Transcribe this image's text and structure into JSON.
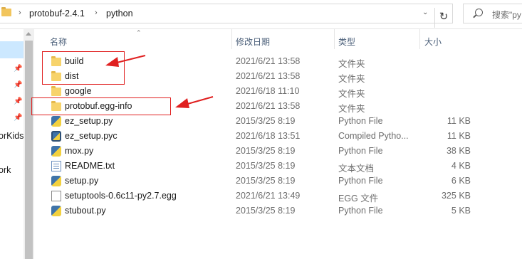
{
  "address": {
    "crumbs": [
      "protobuf-2.4.1",
      "python"
    ],
    "separator": "›",
    "dropdown_icon": "chevron-down-icon",
    "refresh_icon": "refresh-icon"
  },
  "search": {
    "placeholder": "搜索\"py"
  },
  "nav": {
    "labels": [
      "orKids",
      "ork"
    ]
  },
  "columns": {
    "name": "名称",
    "date": "修改日期",
    "type": "类型",
    "size": "大小"
  },
  "files": [
    {
      "name": "build",
      "date": "2021/6/21 13:58",
      "type": "文件夹",
      "size": "",
      "icon": "folder-icon"
    },
    {
      "name": "dist",
      "date": "2021/6/21 13:58",
      "type": "文件夹",
      "size": "",
      "icon": "folder-icon"
    },
    {
      "name": "google",
      "date": "2021/6/18 11:10",
      "type": "文件夹",
      "size": "",
      "icon": "folder-icon"
    },
    {
      "name": "protobuf.egg-info",
      "date": "2021/6/21 13:58",
      "type": "文件夹",
      "size": "",
      "icon": "folder-icon"
    },
    {
      "name": "ez_setup.py",
      "date": "2015/3/25 8:19",
      "type": "Python File",
      "size": "11 KB",
      "icon": "python-file-icon"
    },
    {
      "name": "ez_setup.pyc",
      "date": "2021/6/18 13:51",
      "type": "Compiled Pytho...",
      "size": "11 KB",
      "icon": "compiled-python-icon"
    },
    {
      "name": "mox.py",
      "date": "2015/3/25 8:19",
      "type": "Python File",
      "size": "38 KB",
      "icon": "python-file-icon"
    },
    {
      "name": "README.txt",
      "date": "2015/3/25 8:19",
      "type": "文本文档",
      "size": "4 KB",
      "icon": "text-file-icon"
    },
    {
      "name": "setup.py",
      "date": "2015/3/25 8:19",
      "type": "Python File",
      "size": "6 KB",
      "icon": "python-file-icon"
    },
    {
      "name": "setuptools-0.6c11-py2.7.egg",
      "date": "2021/6/21 13:49",
      "type": "EGG 文件",
      "size": "325 KB",
      "icon": "egg-file-icon"
    },
    {
      "name": "stubout.py",
      "date": "2015/3/25 8:19",
      "type": "Python File",
      "size": "5 KB",
      "icon": "python-file-icon"
    }
  ],
  "colors": {
    "annotation": "#e02020",
    "folder": "#f7d36b",
    "selection": "#cce8ff"
  }
}
